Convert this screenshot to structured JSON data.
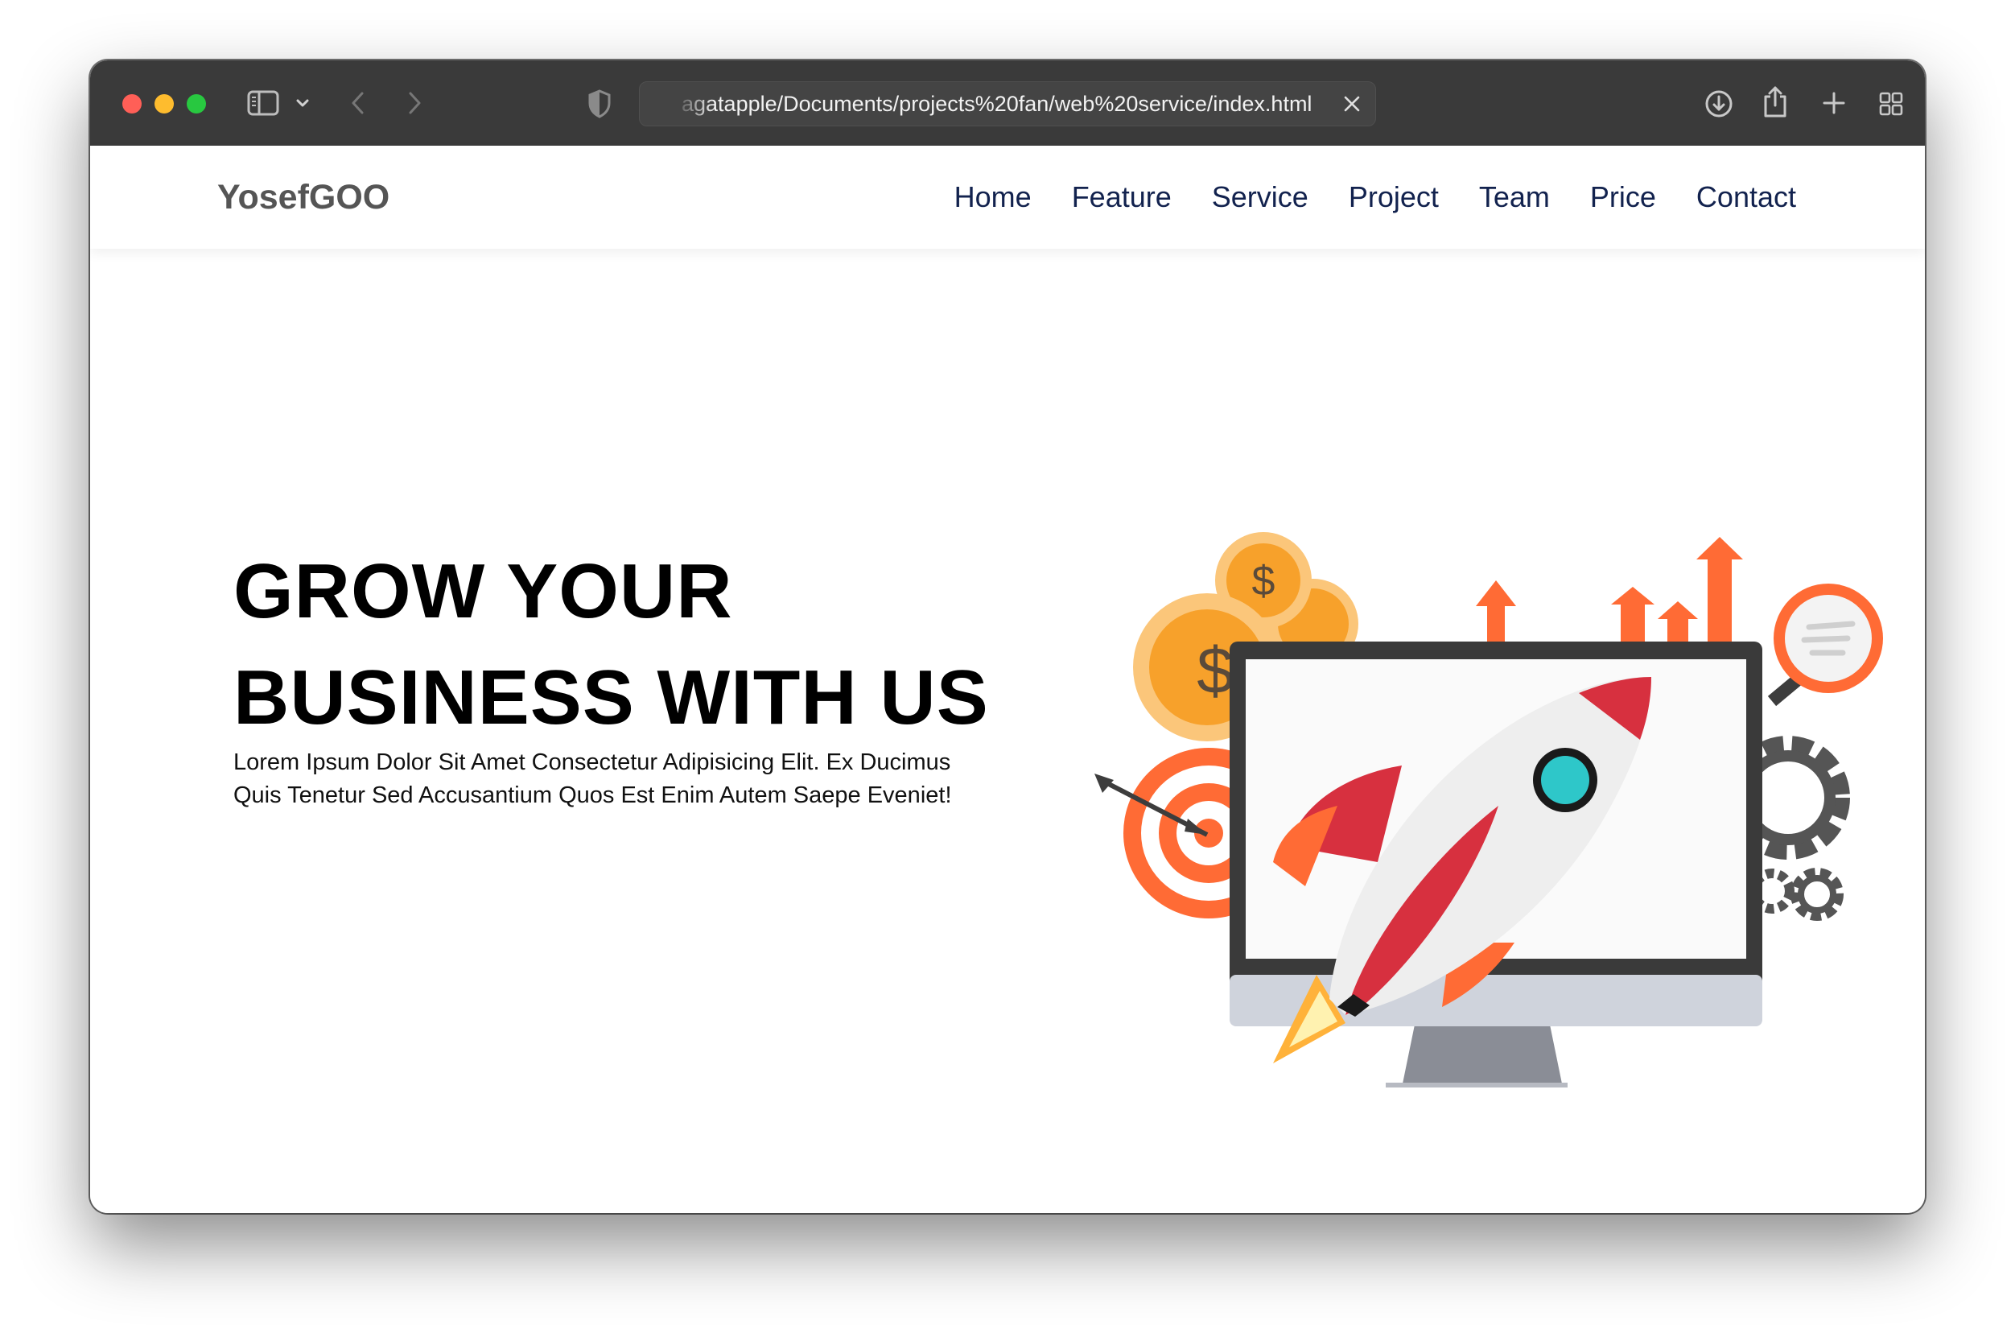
{
  "browser": {
    "url": "agatapple/Documents/projects%20fan/web%20service/index.html",
    "icons": {
      "sidebar": "sidebar-icon",
      "sidebar_menu": "chevron-down-icon",
      "back": "chevron-left-icon",
      "forward": "chevron-right-icon",
      "privacy": "shield-icon",
      "clear": "close-icon",
      "downloads": "download-icon",
      "share": "share-icon",
      "new_tab": "plus-icon",
      "tab_overview": "grid-icon"
    }
  },
  "site": {
    "logo": "YosefGOO",
    "nav": {
      "items": [
        "Home",
        "Feature",
        "Service",
        "Project",
        "Team",
        "Price",
        "Contact"
      ]
    },
    "hero": {
      "title_line1": "GROW YOUR",
      "title_line2": "BUSINESS WITH US",
      "text_line1": "Lorem Ipsum Dolor Sit Amet Consectetur Adipisicing Elit. Ex Ducimus",
      "text_line2": "Quis Tenetur Sed Accusantium Quos Est Enim Autem Saepe Eveniet!",
      "illustration": "rocket-launch-illustration"
    }
  },
  "colors": {
    "titlebar": "#3a3a3a",
    "nav_link": "#12224e",
    "logo": "#555555",
    "accent_orange": "#ff6b35",
    "coin": "#f7a12b",
    "rocket_red": "#d7303f"
  }
}
